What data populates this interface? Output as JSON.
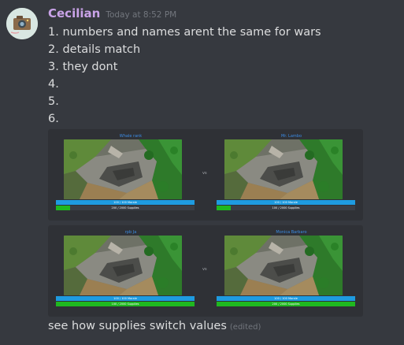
{
  "message": {
    "username": "Cecilian",
    "timestamp": "Today at 8:52 PM",
    "lines": [
      "1. numbers and names arent the same for wars",
      "2. details match",
      "3. they dont",
      "4.",
      "5.",
      "6."
    ],
    "footer_text": "see how supplies switch values",
    "edited_label": "(edited)"
  },
  "colors": {
    "username": "#c9a3e8",
    "morale_bar": "#1e9be0",
    "supplies_bar": "#1fb81f"
  },
  "cards": [
    {
      "vs_label": "vs",
      "left": {
        "name": "Whale rank",
        "morale_text": "100 / 100 Morale",
        "morale_fraction": 1.0,
        "supplies_text": "200 / 2000 Supplies",
        "supplies_fraction": 0.1
      },
      "right": {
        "name": "Mr. Lambo",
        "morale_text": "100 / 100 Morale",
        "morale_fraction": 1.0,
        "supplies_text": "100 / 2000 Supplies",
        "supplies_fraction": 0.1
      }
    },
    {
      "vs_label": "vs",
      "left": {
        "name": "rpb Ja",
        "morale_text": "100 / 100 Morale",
        "morale_fraction": 1.0,
        "supplies_text": "100 / 2000 Supplies",
        "supplies_fraction": 1.0
      },
      "right": {
        "name": "Monica Barbaro",
        "morale_text": "100 / 100 Morale",
        "morale_fraction": 1.0,
        "supplies_text": "200 / 2000 Supplies",
        "supplies_fraction": 1.0
      }
    }
  ]
}
